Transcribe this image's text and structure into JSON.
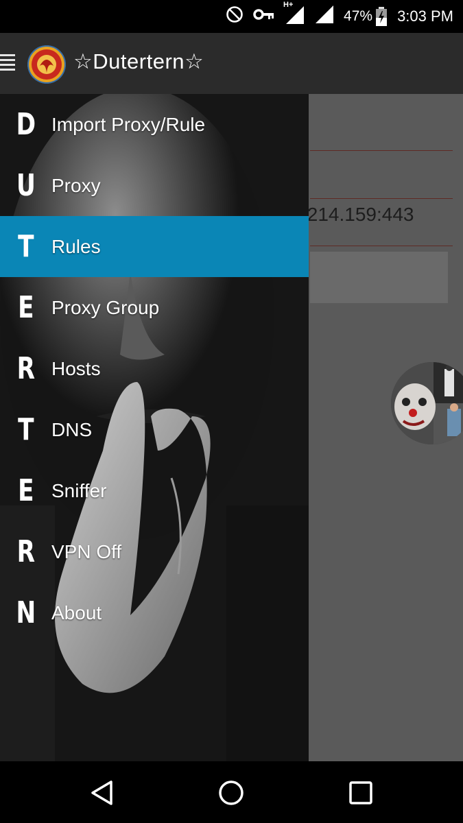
{
  "status_bar": {
    "network_type": "H+",
    "battery": "47%",
    "time": "3:03 PM"
  },
  "app_bar": {
    "title": "☆Dutertern☆",
    "menu_icon": "hamburger-icon",
    "logo": "app-logo"
  },
  "content": {
    "proxy_address_fragment": ".214.159:443"
  },
  "drawer": {
    "items": [
      {
        "letter": "D",
        "label": "Import Proxy/Rule"
      },
      {
        "letter": "U",
        "label": "Proxy"
      },
      {
        "letter": "T",
        "label": "Rules"
      },
      {
        "letter": "E",
        "label": "Proxy Group"
      },
      {
        "letter": "R",
        "label": "Hosts"
      },
      {
        "letter": "T",
        "label": "DNS"
      },
      {
        "letter": "E",
        "label": "Sniffer"
      },
      {
        "letter": "R",
        "label": "VPN Off"
      },
      {
        "letter": "N",
        "label": "About"
      }
    ],
    "active_item": "Rules",
    "accent_color": "#0a86b6"
  },
  "nav_bar": {
    "back_icon": "back-triangle-icon",
    "home_icon": "home-circle-icon",
    "recents_icon": "recents-square-icon"
  }
}
